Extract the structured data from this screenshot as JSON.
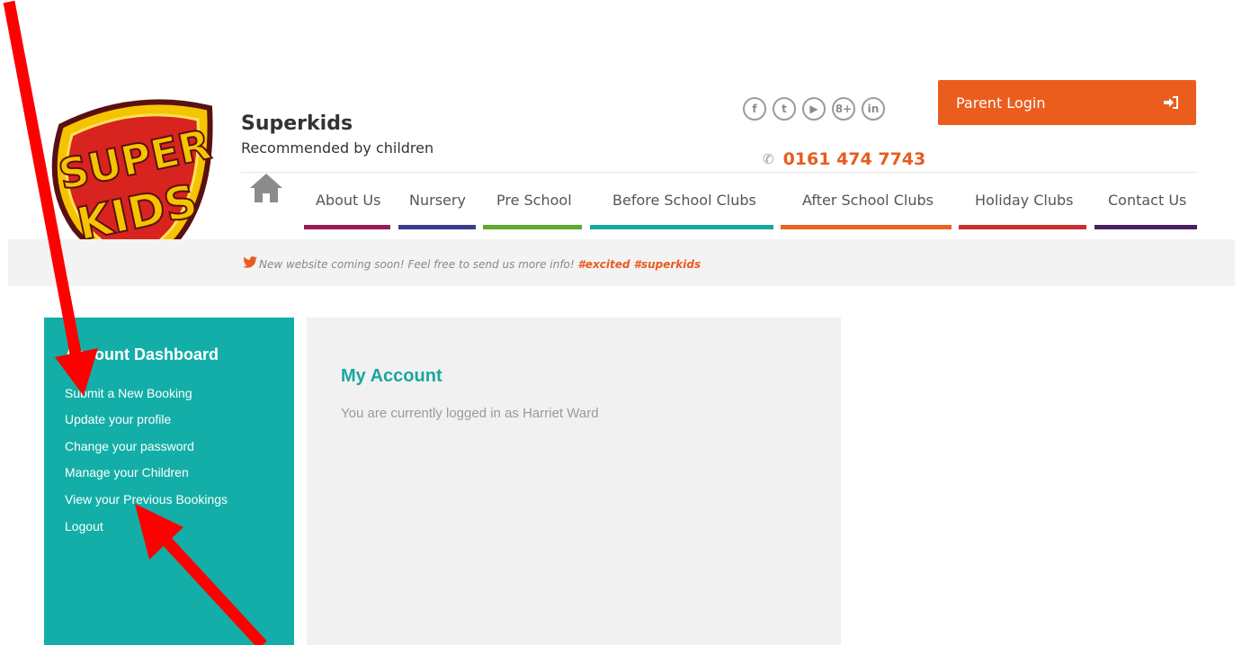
{
  "brand": {
    "title": "Superkids",
    "tagline": "Recommended by children",
    "logo_text": "SUPER KIDS"
  },
  "social": [
    {
      "name": "facebook",
      "glyph": "f"
    },
    {
      "name": "twitter",
      "glyph": "t"
    },
    {
      "name": "youtube",
      "glyph": "▶"
    },
    {
      "name": "google-plus",
      "glyph": "8+"
    },
    {
      "name": "linkedin",
      "glyph": "in"
    }
  ],
  "phone": "0161 474 7743",
  "login": {
    "label": "Parent Login"
  },
  "nav": [
    {
      "label": "About Us",
      "color": "#9b1b5a"
    },
    {
      "label": "Nursery",
      "color": "#3d3a8e"
    },
    {
      "label": "Pre School",
      "color": "#62a72f"
    },
    {
      "label": "Before School Clubs",
      "color": "#16a89a"
    },
    {
      "label": "After School Clubs",
      "color": "#e8641f"
    },
    {
      "label": "Holiday Clubs",
      "color": "#c63030"
    },
    {
      "label": "Contact Us",
      "color": "#4a1f62"
    }
  ],
  "tweet": {
    "text": "New website coming soon! Feel free to send us more info!",
    "tags": "#excited #superkids"
  },
  "sidebar": {
    "title": "Account Dashboard",
    "links": [
      "Submit a New Booking",
      "Update your profile",
      "Change your password",
      "Manage your Children",
      "View your Previous Bookings",
      "Logout"
    ]
  },
  "main": {
    "title": "My Account",
    "text": "You are currently logged in as Harriet Ward"
  },
  "colors": {
    "accent": "#13aea7",
    "orange": "#ea5d1d",
    "annotation": "#ff0000"
  }
}
